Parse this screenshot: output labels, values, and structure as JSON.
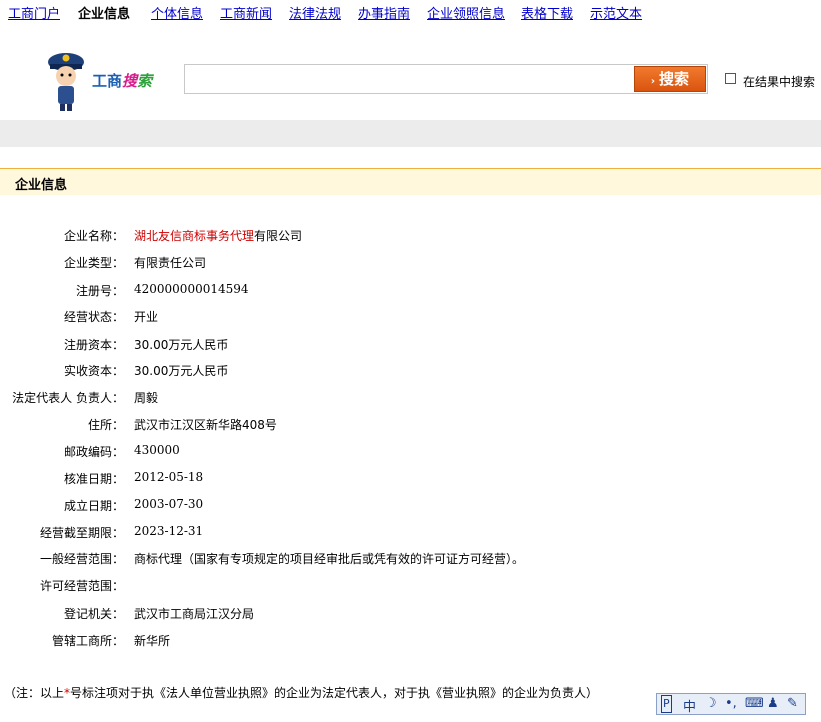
{
  "nav": [
    {
      "label": "工商门户",
      "active": false
    },
    {
      "label": "企业信息",
      "active": true
    },
    {
      "label": "个体信息",
      "active": false
    },
    {
      "label": "工商新闻",
      "active": false
    },
    {
      "label": "法律法规",
      "active": false
    },
    {
      "label": "办事指南",
      "active": false
    },
    {
      "label": "企业领照信息",
      "active": false
    },
    {
      "label": "表格下载",
      "active": false
    },
    {
      "label": "示范文本",
      "active": false
    }
  ],
  "logo": {
    "part1": "工",
    "part2": "商",
    "part3": "搜",
    "part4": "索"
  },
  "search": {
    "value": "",
    "button_label": "搜索",
    "within_results_label": "在结果中搜索",
    "within_results_checked": false
  },
  "panel": {
    "title": "企业信息"
  },
  "fields": [
    {
      "label": "企业名称：",
      "value_red": "湖北友信商标事务代理",
      "value": "有限公司"
    },
    {
      "label": "企业类型：",
      "value": "有限责任公司"
    },
    {
      "label": "注册号：",
      "value": "420000000014594"
    },
    {
      "label": "经营状态：",
      "value": "开业"
    },
    {
      "label": "注册资本：",
      "value": "30.00万元人民币"
    },
    {
      "label": "实收资本：",
      "value": "30.00万元人民币"
    },
    {
      "label": "法定代表人 负责人：",
      "value": "周毅"
    },
    {
      "label": "住所：",
      "value": "武汉市江汉区新华路408号"
    },
    {
      "label": "邮政编码：",
      "value": "430000"
    },
    {
      "label": "核准日期：",
      "value": "2012-05-18"
    },
    {
      "label": "成立日期：",
      "value": "2003-07-30"
    },
    {
      "label": "经营截至期限：",
      "value": "2023-12-31"
    },
    {
      "label": "一般经营范围：",
      "value": "商标代理（国家有专项规定的项目经审批后或凭有效的许可证方可经营）。"
    },
    {
      "label": "许可经营范围：",
      "value": ""
    },
    {
      "label": "登记机关：",
      "value": "武汉市工商局江汉分局"
    },
    {
      "label": "管辖工商所：",
      "value": "新华所"
    }
  ],
  "note": {
    "prefix": "（注：以上",
    "star": "*",
    "suffix": "号标注项对于执《法人单位营业执照》的企业为法定代表人，对于执《营业执照》的企业为负责人）"
  },
  "ime": {
    "items": [
      "中",
      "☽",
      "•,",
      "⌨",
      "♟",
      "✎"
    ]
  }
}
